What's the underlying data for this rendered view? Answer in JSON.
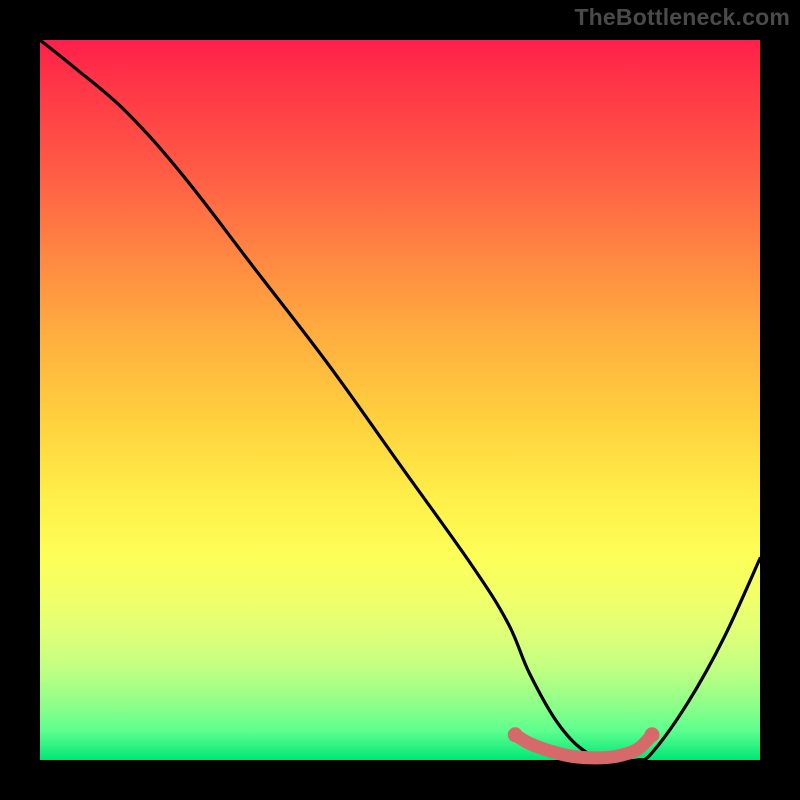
{
  "watermark": "TheBottleneck.com",
  "chart_data": {
    "type": "line",
    "title": "",
    "xlabel": "",
    "ylabel": "",
    "xlim": [
      0,
      100
    ],
    "ylim": [
      0,
      100
    ],
    "series": [
      {
        "name": "bottleneck-curve",
        "x": [
          0,
          5,
          12,
          20,
          30,
          40,
          50,
          60,
          65,
          68,
          72,
          76,
          80,
          83,
          85,
          90,
          95,
          100
        ],
        "y": [
          100,
          96,
          90,
          81,
          68,
          55,
          41,
          27,
          19,
          12,
          5,
          1,
          0,
          0,
          1,
          8,
          17,
          28
        ]
      },
      {
        "name": "highlight-band",
        "x": [
          66,
          68,
          71,
          74,
          77,
          80,
          83,
          85
        ],
        "y": [
          3.5,
          2.3,
          1.2,
          0.5,
          0.3,
          0.5,
          1.5,
          3.5
        ]
      }
    ],
    "colors": {
      "curve": "#000000",
      "highlight": "#d66a6a",
      "background_top": "#ff1f4a",
      "background_bottom": "#00e676"
    }
  }
}
